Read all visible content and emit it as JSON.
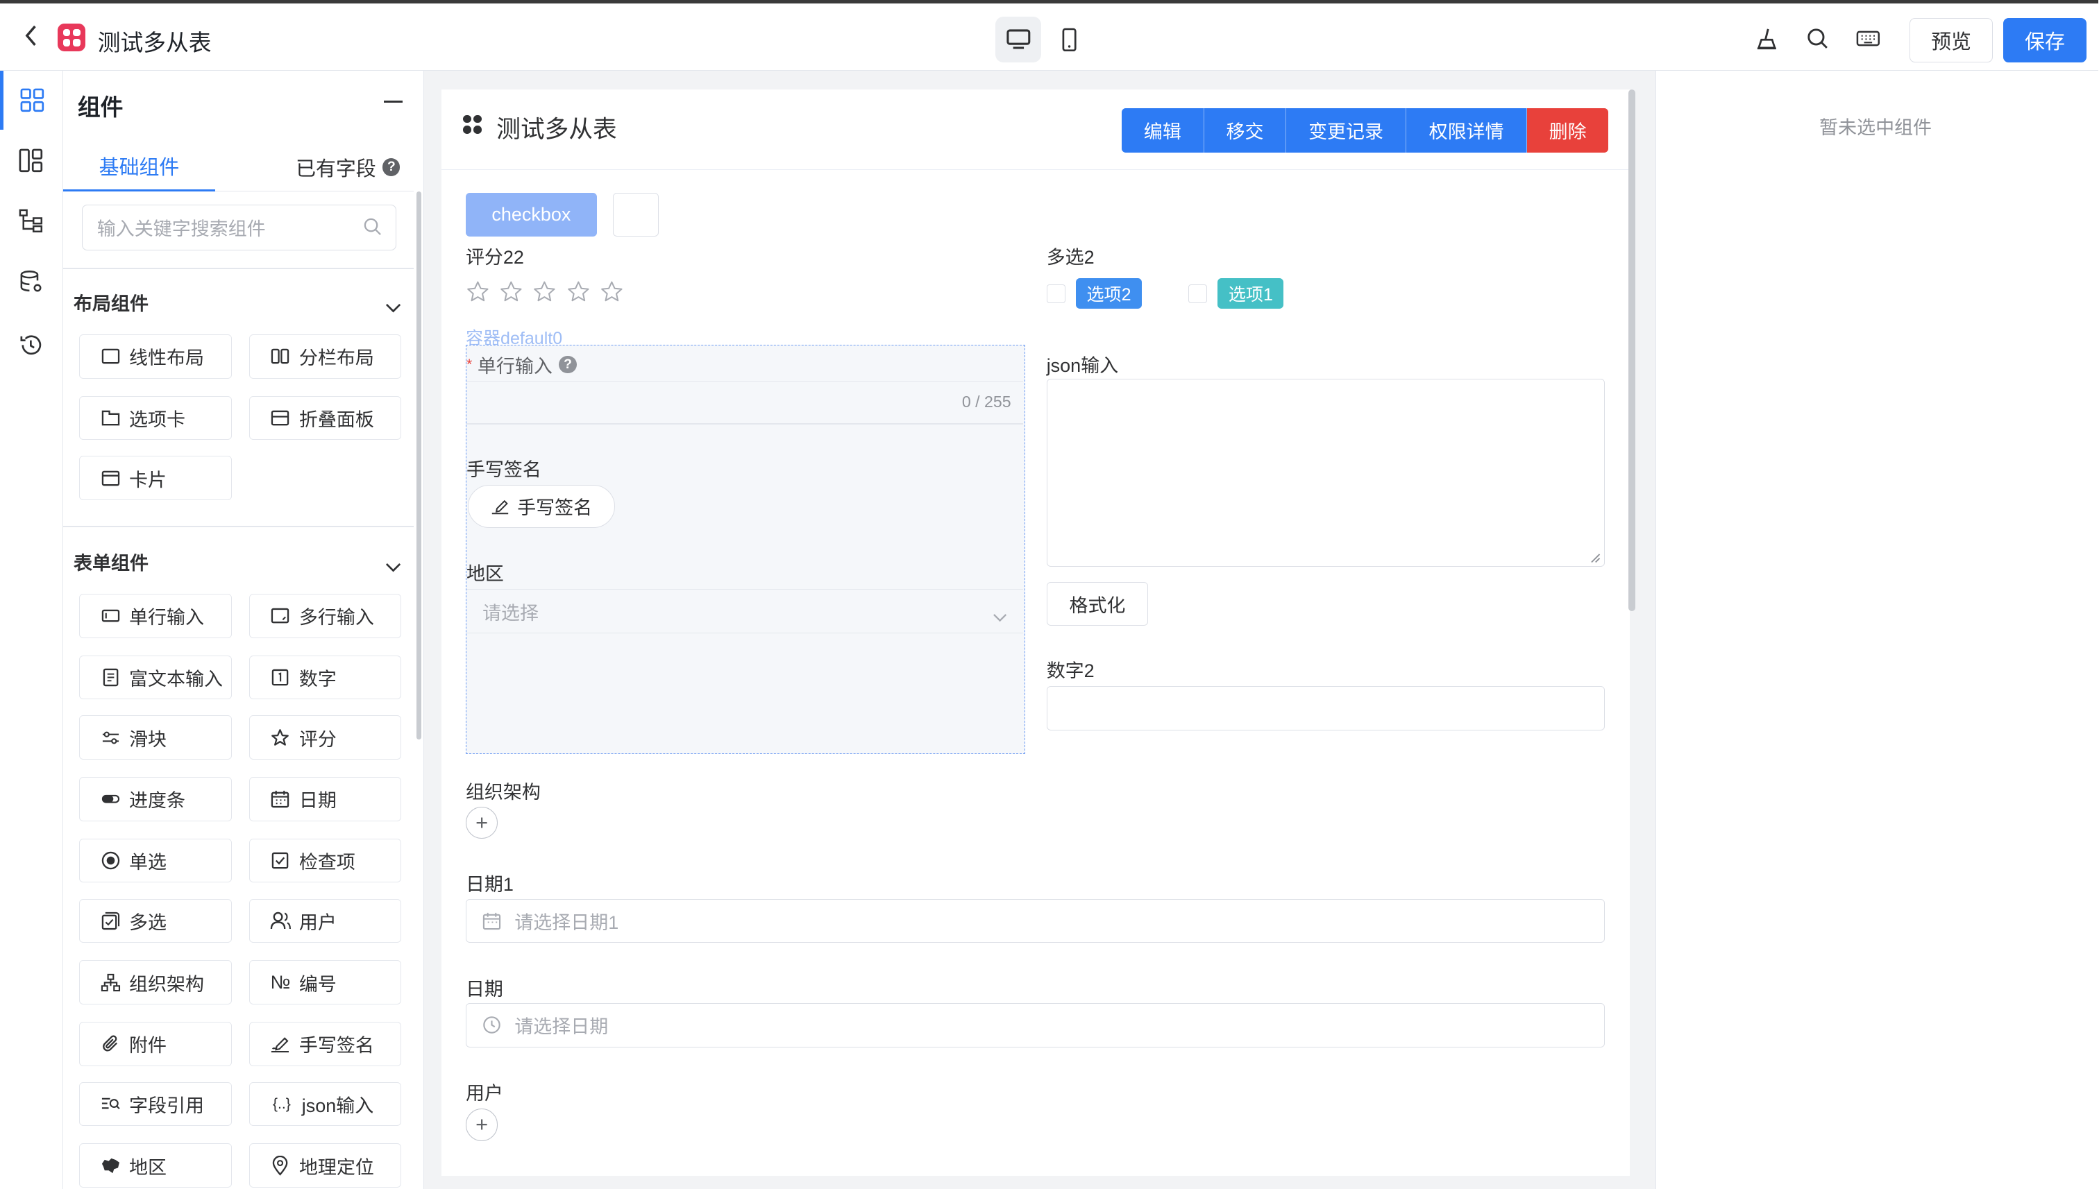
{
  "app": {
    "title": "测试多从表"
  },
  "topbar": {
    "preview_label": "预览",
    "save_label": "保存"
  },
  "panel": {
    "title": "组件",
    "tabs": [
      "基础组件",
      "已有字段"
    ],
    "help_mark": "?",
    "search_placeholder": "输入关键字搜索组件",
    "layout_section": "布局组件",
    "layout_items": [
      "线性布局",
      "分栏布局",
      "选项卡",
      "折叠面板",
      "卡片"
    ],
    "form_section": "表单组件",
    "form_items": [
      "单行输入",
      "多行输入",
      "富文本输入",
      "数字",
      "滑块",
      "评分",
      "进度条",
      "日期",
      "单选",
      "检查项",
      "多选",
      "用户",
      "组织架构",
      "编号",
      "附件",
      "手写签名",
      "字段引用",
      "json输入",
      "地区",
      "地理定位"
    ],
    "number_glyph": "№",
    "json_glyph": "{..}"
  },
  "form": {
    "title": "测试多从表",
    "actions": [
      "编辑",
      "移交",
      "变更记录",
      "权限详情",
      "删除"
    ],
    "checkbox_button": "checkbox",
    "rating_label": "评分22",
    "multi_label": "多选2",
    "multi_options": [
      {
        "label": "选项2",
        "color": "#3f8ff0"
      },
      {
        "label": "选项1",
        "color": "#45c0c6"
      }
    ],
    "container_label": "容器default0",
    "single_input_label": "单行输入",
    "required_mark": "*",
    "help_mark": "?",
    "char_count": "0 / 255",
    "signature_label": "手写签名",
    "signature_button": "手写签名",
    "region_label": "地区",
    "region_placeholder": "请选择",
    "json_label": "json输入",
    "format_button": "格式化",
    "number_label": "数字2",
    "org_label": "组织架构",
    "plus": "+",
    "date1_label": "日期1",
    "date1_placeholder": "请选择日期1",
    "date_label": "日期",
    "date_placeholder": "请选择日期",
    "user_label": "用户"
  },
  "props": {
    "empty_text": "暂未选中组件"
  },
  "colors": {
    "primary": "#2d7bf4",
    "danger": "#e8413b",
    "logo": "#e8385a"
  }
}
